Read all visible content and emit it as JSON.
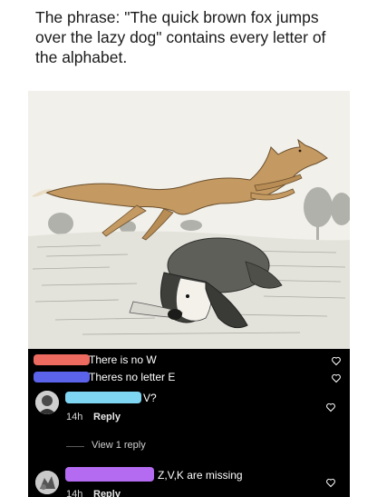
{
  "caption": {
    "text": "The phrase: \"The quick brown fox jumps over the lazy dog\" contains every letter of the alphabet."
  },
  "illustration": {
    "icon": "fox-jumping-over-dog-illustration"
  },
  "comments": [
    {
      "redaction_color": "#ec6a60",
      "text": "There is no W",
      "like_icon": "heart-icon"
    },
    {
      "redaction_color": "#5a63ea",
      "text": "Theres no letter E",
      "like_icon": "heart-icon"
    },
    {
      "redaction_color": "#7fd6f2",
      "text": "V?",
      "time": "14h",
      "reply_label": "Reply",
      "view_replies_label": "View 1 reply",
      "like_icon": "heart-icon"
    },
    {
      "redaction_color": "#b46bf1",
      "text": "Z,V,K are missing",
      "time": "14h",
      "reply_label": "Reply",
      "like_icon": "heart-icon"
    }
  ],
  "colors": {
    "comments_background": "#000000",
    "caption_text": "#1a1a1a"
  }
}
